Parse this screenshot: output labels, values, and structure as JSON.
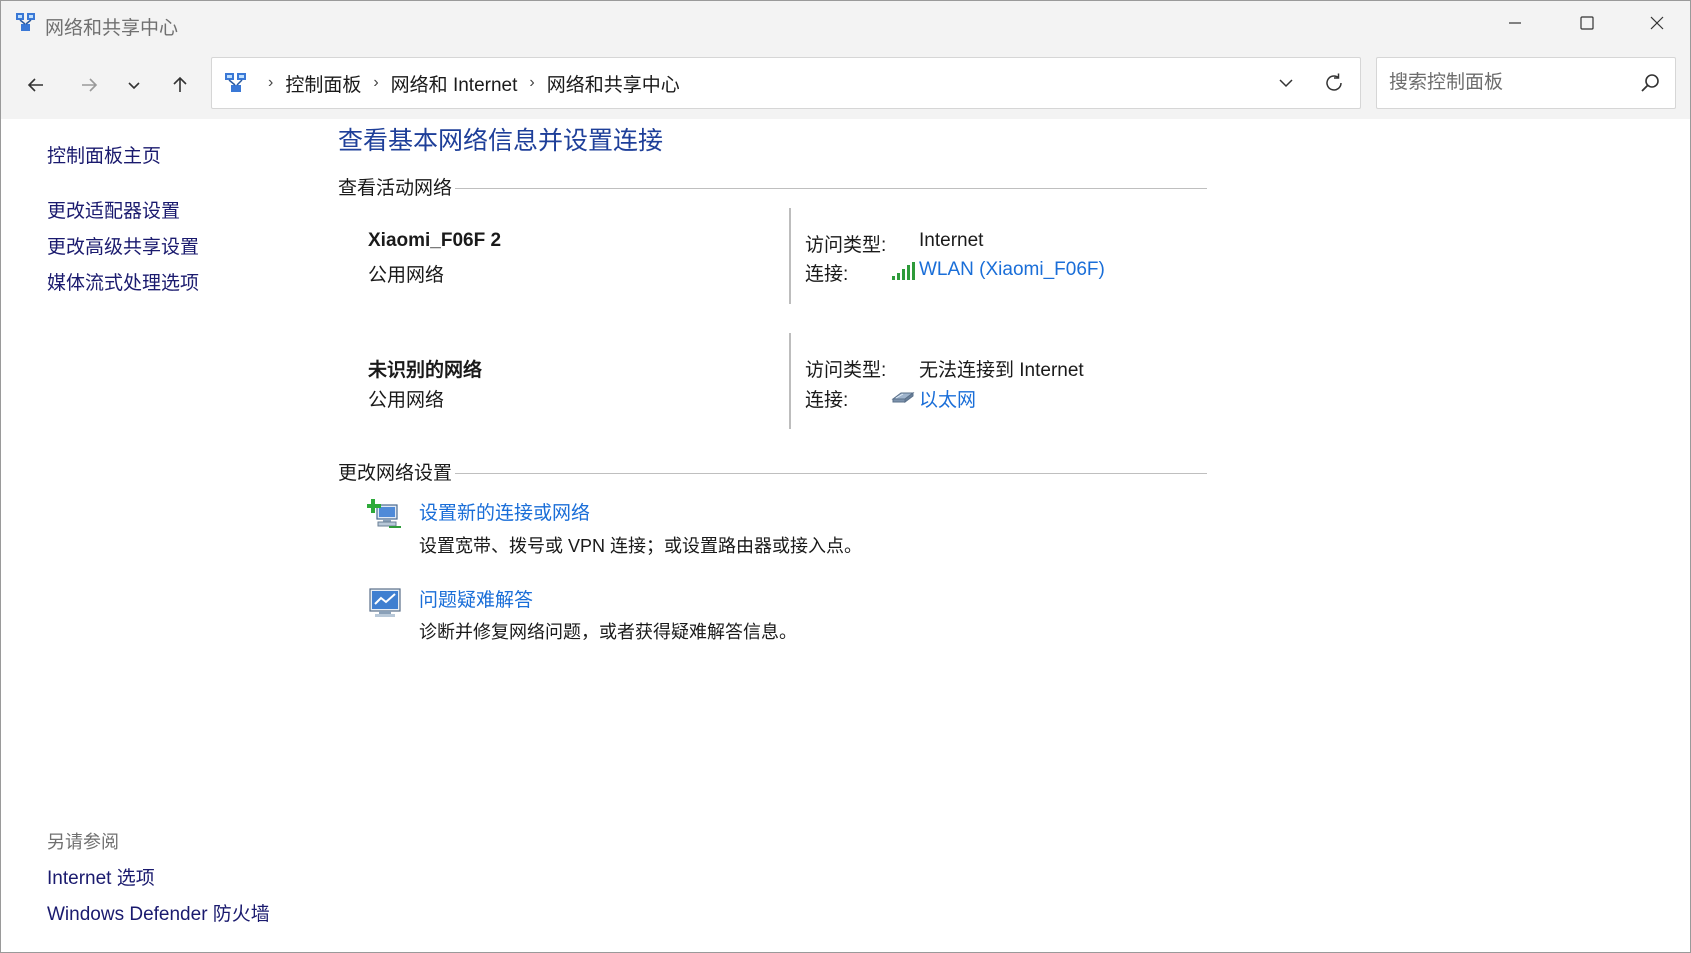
{
  "window": {
    "title": "网络和共享中心"
  },
  "nav": {
    "breadcrumbs": [
      "控制面板",
      "网络和 Internet",
      "网络和共享中心"
    ],
    "breadcrumb_separator": "›"
  },
  "search": {
    "placeholder": "搜索控制面板"
  },
  "sidebar": {
    "home": "控制面板主页",
    "links": [
      "更改适配器设置",
      "更改高级共享设置",
      "媒体流式处理选项"
    ],
    "see_also_heading": "另请参阅",
    "see_also": [
      "Internet 选项",
      "Windows Defender 防火墙"
    ]
  },
  "main": {
    "title": "查看基本网络信息并设置连接",
    "active_networks_heading": "查看活动网络",
    "networks": [
      {
        "name": "Xiaomi_F06F 2",
        "category": "公用网络",
        "access_label": "访问类型:",
        "access_value": "Internet",
        "connection_label": "连接:",
        "connection_value": "WLAN (Xiaomi_F06F)",
        "connection_icon": "wifi-signal-icon"
      },
      {
        "name": "未识别的网络",
        "category": "公用网络",
        "access_label": "访问类型:",
        "access_value": "无法连接到 Internet",
        "connection_label": "连接:",
        "connection_value": "以太网",
        "connection_icon": "ethernet-icon"
      }
    ],
    "change_settings_heading": "更改网络设置",
    "tasks": [
      {
        "title": "设置新的连接或网络",
        "description": "设置宽带、拨号或 VPN 连接；或设置路由器或接入点。",
        "icon": "new-connection-icon"
      },
      {
        "title": "问题疑难解答",
        "description": "诊断并修复网络问题，或者获得疑难解答信息。",
        "icon": "troubleshoot-icon"
      }
    ]
  },
  "colors": {
    "title_blue": "#1e3f99",
    "link_blue": "#1a6ed8",
    "sidebar_link": "#1a1a6e",
    "chrome_bg": "#f3f3f3"
  }
}
